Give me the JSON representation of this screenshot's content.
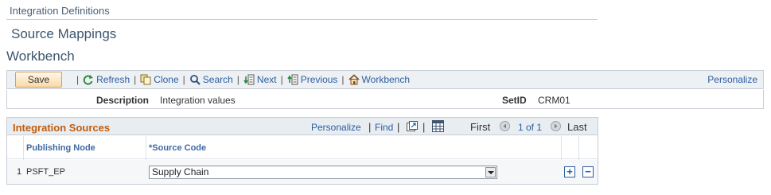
{
  "breadcrumb": "Integration Definitions",
  "page_title": "Source Mappings",
  "section_title": "Workbench",
  "toolbar": {
    "save_label": "Save",
    "refresh_label": "Refresh",
    "clone_label": "Clone",
    "search_label": "Search",
    "next_label": "Next",
    "previous_label": "Previous",
    "workbench_label": "Workbench",
    "personalize_label": "Personalize",
    "separator": "|"
  },
  "header_fields": {
    "description_label": "Description",
    "description_value": "Integration values",
    "setid_label": "SetID",
    "setid_value": "CRM01"
  },
  "grid": {
    "title": "Integration Sources",
    "personalize_label": "Personalize",
    "separator": "|",
    "find_label": "Find",
    "first_label": "First",
    "page_indicator": "1 of 1",
    "last_label": "Last",
    "columns": [
      "Publishing Node",
      "*Source Code"
    ],
    "rows": [
      {
        "num": "1",
        "publishing_node": "PSFT_EP",
        "source_code": "Supply Chain"
      }
    ],
    "add_label": "+",
    "remove_label": "−"
  }
}
